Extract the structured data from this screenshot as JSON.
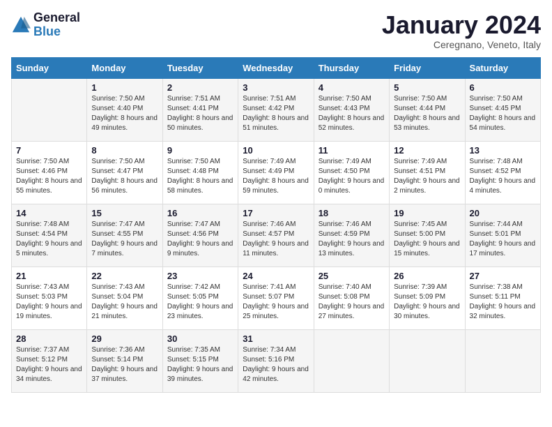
{
  "logo": {
    "general": "General",
    "blue": "Blue"
  },
  "header": {
    "title": "January 2024",
    "location": "Ceregnano, Veneto, Italy"
  },
  "days_of_week": [
    "Sunday",
    "Monday",
    "Tuesday",
    "Wednesday",
    "Thursday",
    "Friday",
    "Saturday"
  ],
  "weeks": [
    [
      {
        "day": "",
        "sunrise": "",
        "sunset": "",
        "daylight": ""
      },
      {
        "day": "1",
        "sunrise": "Sunrise: 7:50 AM",
        "sunset": "Sunset: 4:40 PM",
        "daylight": "Daylight: 8 hours and 49 minutes."
      },
      {
        "day": "2",
        "sunrise": "Sunrise: 7:51 AM",
        "sunset": "Sunset: 4:41 PM",
        "daylight": "Daylight: 8 hours and 50 minutes."
      },
      {
        "day": "3",
        "sunrise": "Sunrise: 7:51 AM",
        "sunset": "Sunset: 4:42 PM",
        "daylight": "Daylight: 8 hours and 51 minutes."
      },
      {
        "day": "4",
        "sunrise": "Sunrise: 7:50 AM",
        "sunset": "Sunset: 4:43 PM",
        "daylight": "Daylight: 8 hours and 52 minutes."
      },
      {
        "day": "5",
        "sunrise": "Sunrise: 7:50 AM",
        "sunset": "Sunset: 4:44 PM",
        "daylight": "Daylight: 8 hours and 53 minutes."
      },
      {
        "day": "6",
        "sunrise": "Sunrise: 7:50 AM",
        "sunset": "Sunset: 4:45 PM",
        "daylight": "Daylight: 8 hours and 54 minutes."
      }
    ],
    [
      {
        "day": "7",
        "sunrise": "Sunrise: 7:50 AM",
        "sunset": "Sunset: 4:46 PM",
        "daylight": "Daylight: 8 hours and 55 minutes."
      },
      {
        "day": "8",
        "sunrise": "Sunrise: 7:50 AM",
        "sunset": "Sunset: 4:47 PM",
        "daylight": "Daylight: 8 hours and 56 minutes."
      },
      {
        "day": "9",
        "sunrise": "Sunrise: 7:50 AM",
        "sunset": "Sunset: 4:48 PM",
        "daylight": "Daylight: 8 hours and 58 minutes."
      },
      {
        "day": "10",
        "sunrise": "Sunrise: 7:49 AM",
        "sunset": "Sunset: 4:49 PM",
        "daylight": "Daylight: 8 hours and 59 minutes."
      },
      {
        "day": "11",
        "sunrise": "Sunrise: 7:49 AM",
        "sunset": "Sunset: 4:50 PM",
        "daylight": "Daylight: 9 hours and 0 minutes."
      },
      {
        "day": "12",
        "sunrise": "Sunrise: 7:49 AM",
        "sunset": "Sunset: 4:51 PM",
        "daylight": "Daylight: 9 hours and 2 minutes."
      },
      {
        "day": "13",
        "sunrise": "Sunrise: 7:48 AM",
        "sunset": "Sunset: 4:52 PM",
        "daylight": "Daylight: 9 hours and 4 minutes."
      }
    ],
    [
      {
        "day": "14",
        "sunrise": "Sunrise: 7:48 AM",
        "sunset": "Sunset: 4:54 PM",
        "daylight": "Daylight: 9 hours and 5 minutes."
      },
      {
        "day": "15",
        "sunrise": "Sunrise: 7:47 AM",
        "sunset": "Sunset: 4:55 PM",
        "daylight": "Daylight: 9 hours and 7 minutes."
      },
      {
        "day": "16",
        "sunrise": "Sunrise: 7:47 AM",
        "sunset": "Sunset: 4:56 PM",
        "daylight": "Daylight: 9 hours and 9 minutes."
      },
      {
        "day": "17",
        "sunrise": "Sunrise: 7:46 AM",
        "sunset": "Sunset: 4:57 PM",
        "daylight": "Daylight: 9 hours and 11 minutes."
      },
      {
        "day": "18",
        "sunrise": "Sunrise: 7:46 AM",
        "sunset": "Sunset: 4:59 PM",
        "daylight": "Daylight: 9 hours and 13 minutes."
      },
      {
        "day": "19",
        "sunrise": "Sunrise: 7:45 AM",
        "sunset": "Sunset: 5:00 PM",
        "daylight": "Daylight: 9 hours and 15 minutes."
      },
      {
        "day": "20",
        "sunrise": "Sunrise: 7:44 AM",
        "sunset": "Sunset: 5:01 PM",
        "daylight": "Daylight: 9 hours and 17 minutes."
      }
    ],
    [
      {
        "day": "21",
        "sunrise": "Sunrise: 7:43 AM",
        "sunset": "Sunset: 5:03 PM",
        "daylight": "Daylight: 9 hours and 19 minutes."
      },
      {
        "day": "22",
        "sunrise": "Sunrise: 7:43 AM",
        "sunset": "Sunset: 5:04 PM",
        "daylight": "Daylight: 9 hours and 21 minutes."
      },
      {
        "day": "23",
        "sunrise": "Sunrise: 7:42 AM",
        "sunset": "Sunset: 5:05 PM",
        "daylight": "Daylight: 9 hours and 23 minutes."
      },
      {
        "day": "24",
        "sunrise": "Sunrise: 7:41 AM",
        "sunset": "Sunset: 5:07 PM",
        "daylight": "Daylight: 9 hours and 25 minutes."
      },
      {
        "day": "25",
        "sunrise": "Sunrise: 7:40 AM",
        "sunset": "Sunset: 5:08 PM",
        "daylight": "Daylight: 9 hours and 27 minutes."
      },
      {
        "day": "26",
        "sunrise": "Sunrise: 7:39 AM",
        "sunset": "Sunset: 5:09 PM",
        "daylight": "Daylight: 9 hours and 30 minutes."
      },
      {
        "day": "27",
        "sunrise": "Sunrise: 7:38 AM",
        "sunset": "Sunset: 5:11 PM",
        "daylight": "Daylight: 9 hours and 32 minutes."
      }
    ],
    [
      {
        "day": "28",
        "sunrise": "Sunrise: 7:37 AM",
        "sunset": "Sunset: 5:12 PM",
        "daylight": "Daylight: 9 hours and 34 minutes."
      },
      {
        "day": "29",
        "sunrise": "Sunrise: 7:36 AM",
        "sunset": "Sunset: 5:14 PM",
        "daylight": "Daylight: 9 hours and 37 minutes."
      },
      {
        "day": "30",
        "sunrise": "Sunrise: 7:35 AM",
        "sunset": "Sunset: 5:15 PM",
        "daylight": "Daylight: 9 hours and 39 minutes."
      },
      {
        "day": "31",
        "sunrise": "Sunrise: 7:34 AM",
        "sunset": "Sunset: 5:16 PM",
        "daylight": "Daylight: 9 hours and 42 minutes."
      },
      {
        "day": "",
        "sunrise": "",
        "sunset": "",
        "daylight": ""
      },
      {
        "day": "",
        "sunrise": "",
        "sunset": "",
        "daylight": ""
      },
      {
        "day": "",
        "sunrise": "",
        "sunset": "",
        "daylight": ""
      }
    ]
  ]
}
